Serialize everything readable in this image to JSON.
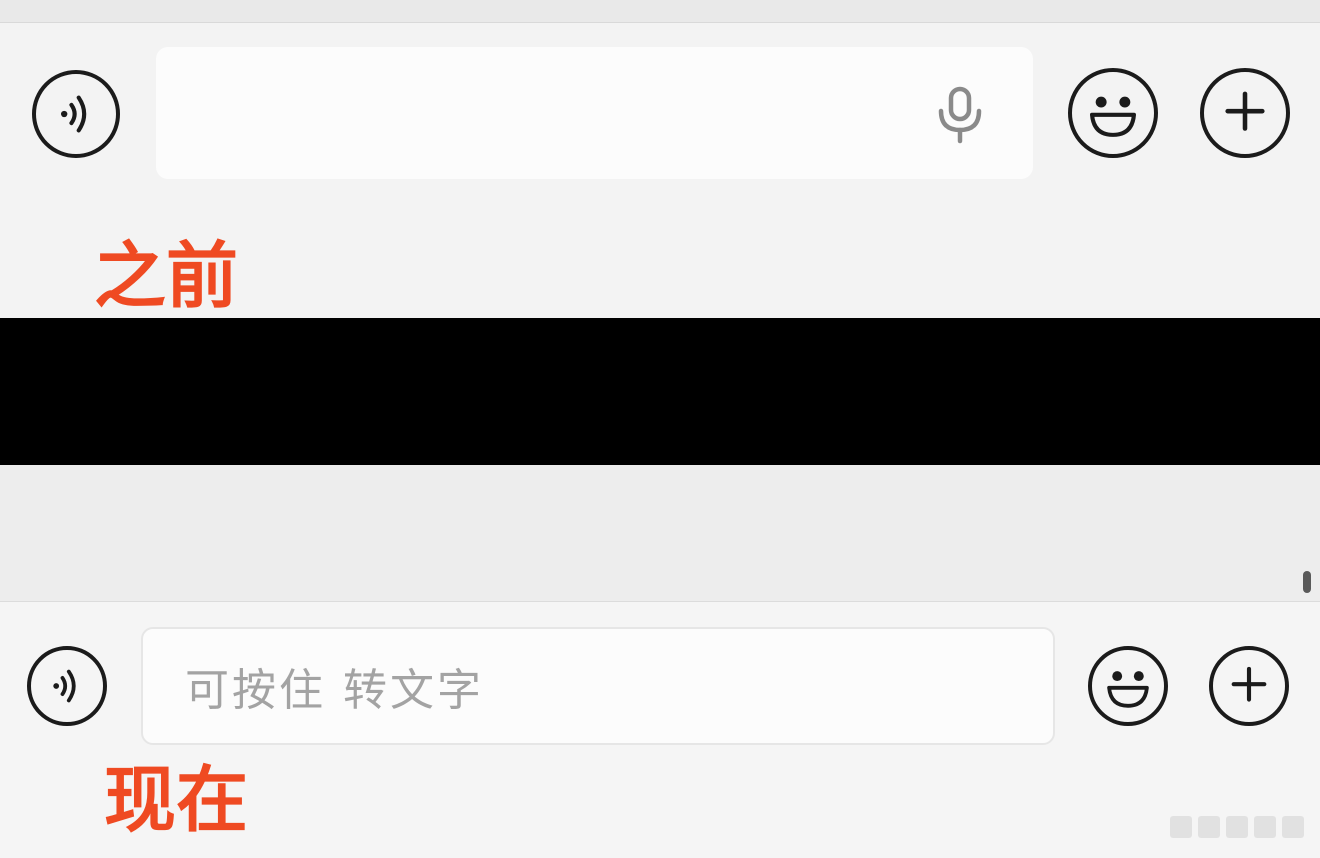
{
  "before": {
    "caption": "之前",
    "icons": {
      "voice": "voice-wave-icon",
      "mic": "microphone-icon",
      "emoji": "smiley-face-icon",
      "plus": "plus-icon"
    }
  },
  "after": {
    "caption": "现在",
    "input_placeholder": "可按住 转文字",
    "icons": {
      "voice": "voice-wave-icon",
      "emoji": "smiley-face-icon",
      "plus": "plus-icon"
    }
  },
  "colors": {
    "annotation": "#ef4a22",
    "icon_stroke": "#1b1b1b",
    "placeholder": "#a3a3a3",
    "redaction": "#000000"
  }
}
